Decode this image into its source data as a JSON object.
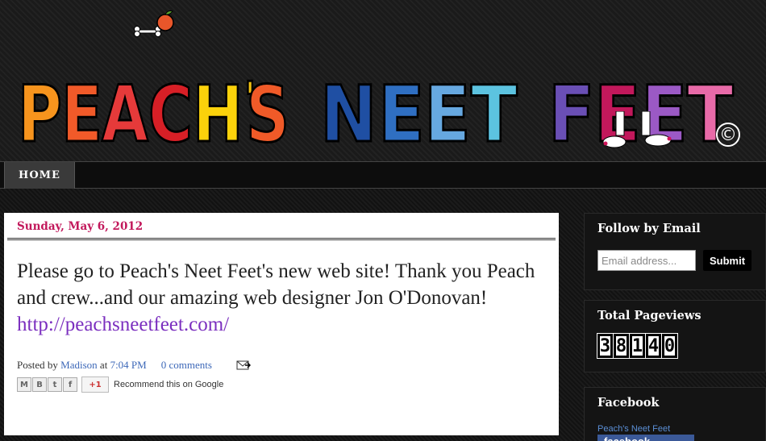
{
  "header": {
    "logo_word1": [
      "P",
      "E",
      "A",
      "C",
      "H",
      "'",
      "S"
    ],
    "logo_word2": [
      "N",
      "E",
      "E",
      "T"
    ],
    "logo_word3": [
      "F",
      "E",
      "E",
      "T"
    ],
    "logo_colors1": [
      "#f7941d",
      "#f15a29",
      "#e63a3a",
      "#d71f26",
      "#fbd20b",
      "#f4c310",
      "#f05a28"
    ],
    "logo_colors2": [
      "#1f4fa3",
      "#2f6fc2",
      "#66a8e0",
      "#5cc3e0"
    ],
    "logo_colors3": [
      "#6a4fb5",
      "#c2185b",
      "#9b59c5",
      "#e86aa8"
    ],
    "copyright_symbol": "©"
  },
  "nav": {
    "home_label": "HOME"
  },
  "post": {
    "date": "Sunday, May 6, 2012",
    "body_text": "Please go to Peach's Neet Feet's new web site!  Thank you Peach and crew...and our amazing web designer Jon O'Donovan!",
    "link_text": "http://peachsneetfeet.com/",
    "posted_by_label": "Posted by",
    "author": "Madison",
    "at_label": "at",
    "time": "7:04 PM",
    "comments": "0 comments",
    "share_buttons": [
      "M",
      "B",
      "t",
      "f"
    ],
    "gplus_label": "+1",
    "recommend_text": "Recommend this on Google"
  },
  "sidebar": {
    "follow_title": "Follow by Email",
    "email_placeholder": "Email address...",
    "submit_label": "Submit",
    "pageviews_title": "Total Pageviews",
    "pageviews_digits": [
      "3",
      "8",
      "1",
      "4",
      "0"
    ],
    "facebook_title": "Facebook",
    "facebook_page_link": "Peach's Neet Feet",
    "facebook_badge": "facebook"
  }
}
